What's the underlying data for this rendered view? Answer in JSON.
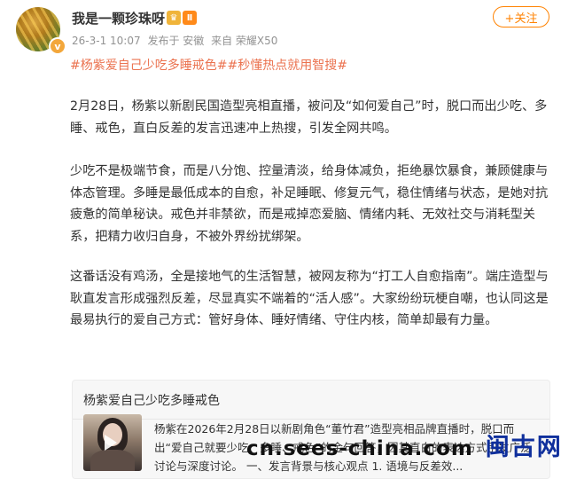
{
  "post": {
    "username": "我是一颗珍珠呀",
    "badge_icons": [
      "crown-icon",
      "member-badge-icon"
    ],
    "badge_text": "Ⅱ",
    "verified_symbol": "v",
    "date": "26-3-1 10:07",
    "location": "发布于 安徽",
    "device": "来自 荣耀X50",
    "follow_label": "+关注",
    "topics": "#杨紫爱自己少吃多睡戒色##秒懂热点就用智搜#",
    "paragraphs": [
      "2月28日，杨紫以新剧民国造型亮相直播，被问及“如何爱自己”时，脱口而出少吃、多睡、戒色，直白反差的发言迅速冲上热搜，引发全网共鸣。",
      "少吃不是极端节食，而是八分饱、控量清淡，给身体减负，拒绝暴饮暴食，兼顾健康与体态管理。多睡是最低成本的自愈，补足睡眠、修复元气，稳住情绪与状态，是她对抗疲惫的简单秘诀。戒色并非禁欲，而是戒掉恋爱脑、情绪内耗、无效社交与消耗型关系，把精力收归自身，不被外界纷扰绑架。",
      "这番话没有鸡汤，全是接地气的生活智慧，被网友称为“打工人自愈指南”。端庄造型与耿直发言形成强烈反差，尽显真实不端着的“活人感”。大家纷纷玩梗自嘲，也认同这是最易执行的爱自己方式：管好身体、睡好情绪、守住内核，简单却最有力量。"
    ]
  },
  "card": {
    "title": "杨紫爱自己少吃多睡戒色",
    "summary": "杨紫在2026年2月28日以新剧角色“董竹君”造型亮相品牌直播时，脱口而出“爱自己就要少吃、多睡、戒色”的金句回答，因其直白的表达方式引发广泛讨论与深度讨论。 一、发言背景与核心观点 1. 语境与反差效..."
  },
  "watermark": {
    "domain": "cn.sees-china.com",
    "cn_text": "闽古网"
  }
}
